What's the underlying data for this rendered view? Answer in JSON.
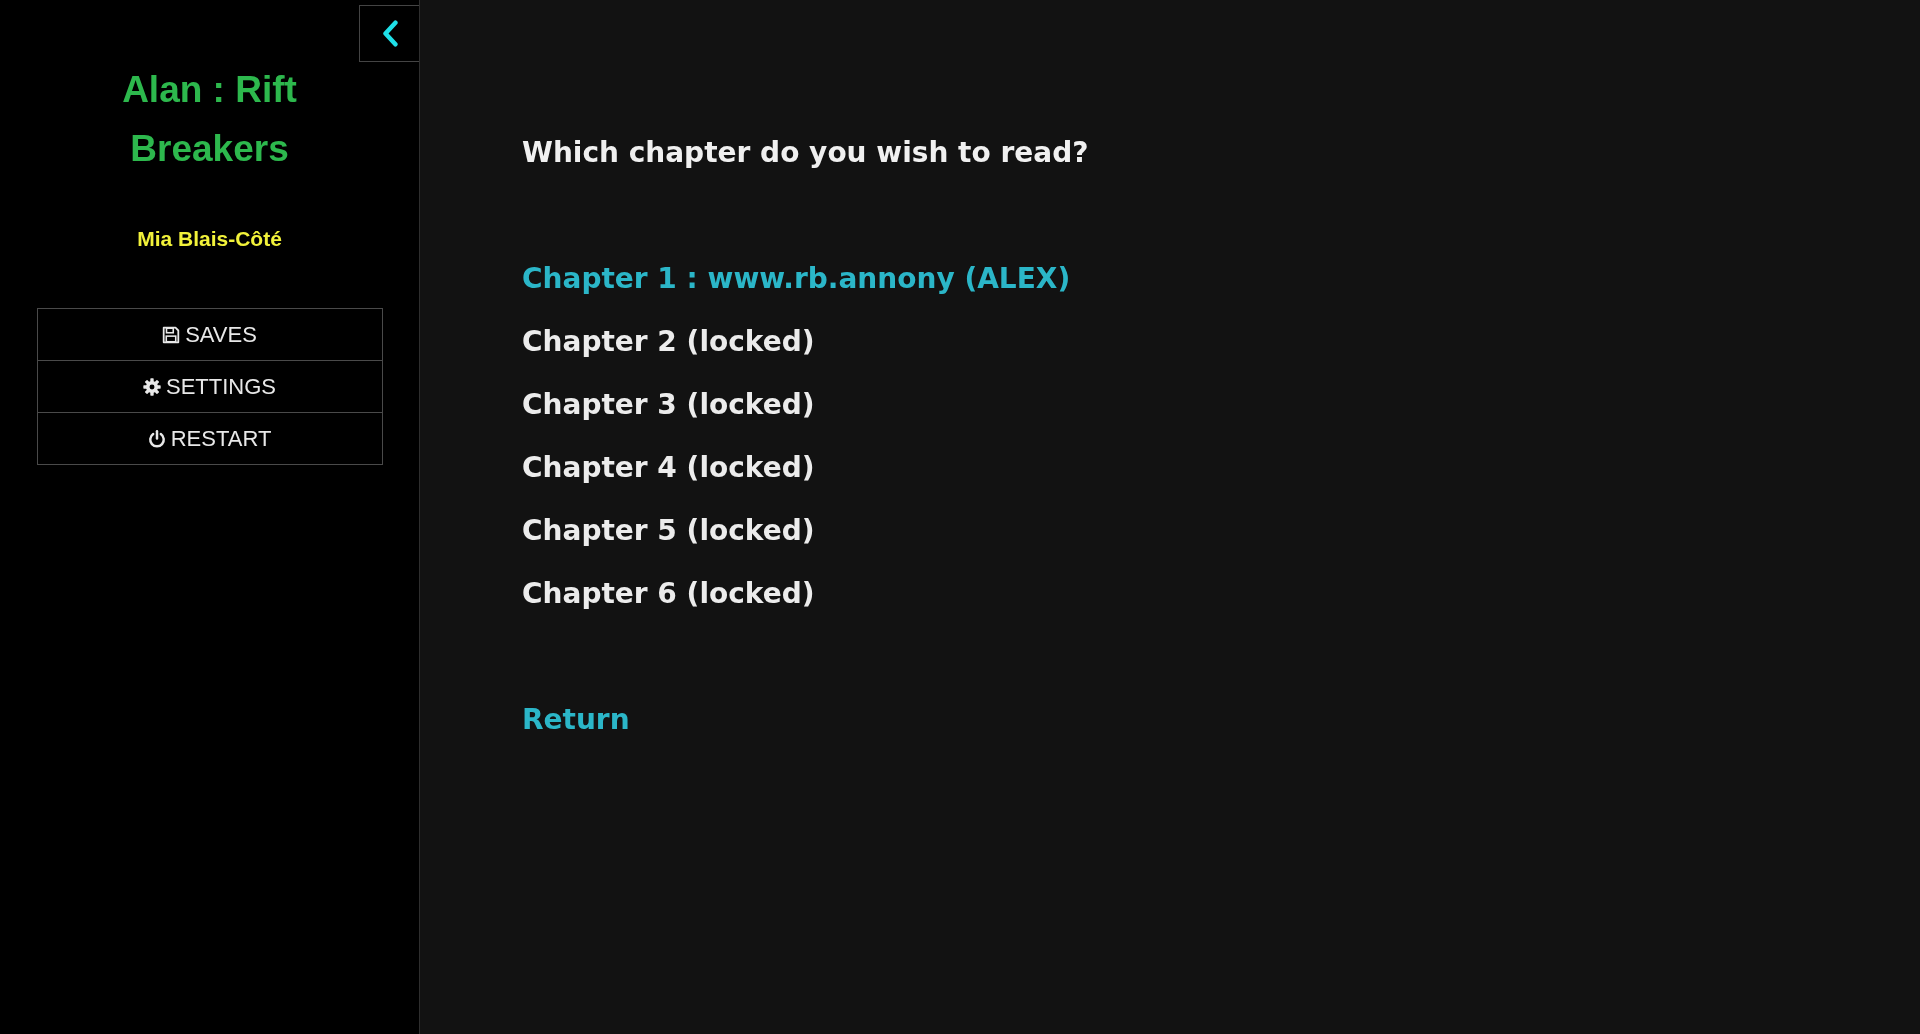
{
  "sidebar": {
    "title": "Alan : Rift Breakers",
    "author": "Mia Blais-Côté",
    "menu": [
      {
        "label": "SAVES",
        "kind": "save"
      },
      {
        "label": "SETTINGS",
        "kind": "settings"
      },
      {
        "label": "RESTART",
        "kind": "restart"
      }
    ]
  },
  "main": {
    "prompt": "Which chapter do you wish to read?",
    "chapters": [
      {
        "label": "Chapter 1 : www.rb.annony (ALEX)",
        "locked": false
      },
      {
        "label": "Chapter 2 (locked)",
        "locked": true
      },
      {
        "label": "Chapter 3 (locked)",
        "locked": true
      },
      {
        "label": "Chapter 4 (locked)",
        "locked": true
      },
      {
        "label": "Chapter 5 (locked)",
        "locked": true
      },
      {
        "label": "Chapter 6 (locked)",
        "locked": true
      }
    ],
    "return_link": "Return"
  }
}
